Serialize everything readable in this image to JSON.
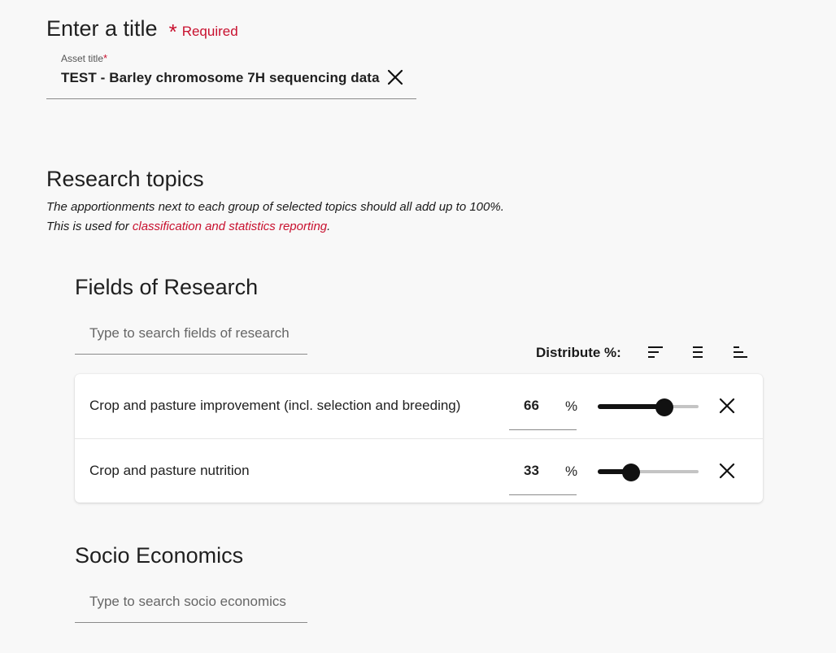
{
  "title_section": {
    "heading": "Enter a title",
    "required_star": "*",
    "required_text": "Required",
    "field_label": "Asset title",
    "field_label_star": "*",
    "field_value": "TEST - Barley chromosome 7H sequencing data"
  },
  "research_topics": {
    "heading": "Research topics",
    "desc_line1": "The apportionments next to each group of selected topics should all add up to 100%.",
    "desc_line2_prefix": "This is used for ",
    "desc_link": "classification and statistics reporting",
    "desc_line2_suffix": "."
  },
  "fields_of_research": {
    "heading": "Fields of Research",
    "search_placeholder": "Type to search fields of research",
    "distribute_label": "Distribute %:",
    "distribute_icons": [
      "sort-descending-icon",
      "equal-distribute-icon",
      "sort-ascending-icon"
    ],
    "rows": [
      {
        "label": "Crop and pasture improvement (incl. selection and breeding)",
        "percent": "66",
        "unit": "%",
        "slider_fraction": 0.66
      },
      {
        "label": "Crop and pasture nutrition",
        "percent": "33",
        "unit": "%",
        "slider_fraction": 0.33
      }
    ]
  },
  "socio_economics": {
    "heading": "Socio Economics",
    "search_placeholder": "Type to search socio economics"
  },
  "colors": {
    "accent": "#c8102e",
    "slider_fill": "#111111",
    "slider_track": "#c4c4c4"
  }
}
